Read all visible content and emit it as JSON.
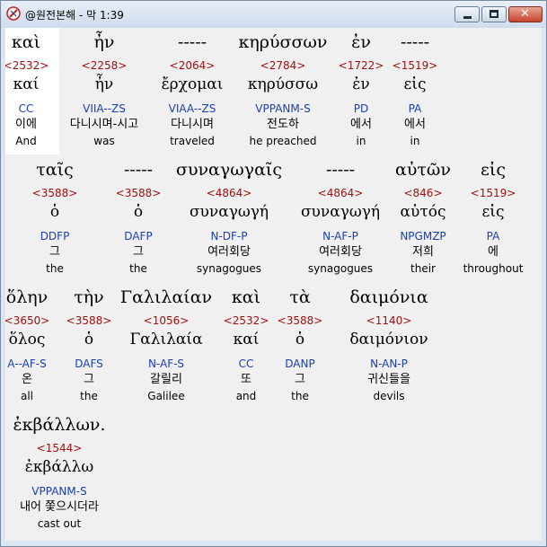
{
  "window": {
    "title": "@원전본해 - 막 1:39",
    "icon": "app-logo-icon",
    "controls": {
      "minimize": "minimize-icon",
      "maximize": "maximize-icon",
      "close": "close-icon"
    }
  },
  "rows": [
    {
      "words": [
        {
          "greek": "καὶ",
          "strong": "<2532>",
          "lemma": "καί",
          "parse": "CC",
          "korean": "이에",
          "english": "And"
        },
        {
          "greek": "ἦν",
          "strong": "<2258>",
          "lemma": "ἦν",
          "parse": "VIIA--ZS",
          "korean": "다니시며-시고",
          "english": "was"
        },
        {
          "greek": "-----",
          "strong": "<2064>",
          "lemma": "ἔρχομαι",
          "parse": "VIAA--ZS",
          "korean": "다니시며",
          "english": "traveled"
        },
        {
          "greek": "κηρύσσων",
          "strong": "<2784>",
          "lemma": "κηρύσσω",
          "parse": "VPPANM-S",
          "korean": "전도하",
          "english": "he preached"
        },
        {
          "greek": "ἐν",
          "strong": "<1722>",
          "lemma": "ἐν",
          "parse": "PD",
          "korean": "에서",
          "english": "in"
        },
        {
          "greek": "-----",
          "strong": "<1519>",
          "lemma": "εἰς",
          "parse": "PA",
          "korean": "에서",
          "english": "in"
        }
      ]
    },
    {
      "words": [
        {
          "greek": "ταῖς",
          "strong": "<3588>",
          "lemma": "ὁ",
          "parse": "DDFP",
          "korean": "그",
          "english": "the"
        },
        {
          "greek": "-----",
          "strong": "<3588>",
          "lemma": "ὁ",
          "parse": "DAFP",
          "korean": "그",
          "english": "the"
        },
        {
          "greek": "συναγωγαῖς",
          "strong": "<4864>",
          "lemma": "συναγωγή",
          "parse": "N-DF-P",
          "korean": "여러회당",
          "english": "synagogues"
        },
        {
          "greek": "-----",
          "strong": "<4864>",
          "lemma": "συναγωγή",
          "parse": "N-AF-P",
          "korean": "여러회당",
          "english": "synagogues"
        },
        {
          "greek": "αὐτῶν",
          "strong": "<846>",
          "lemma": "αὐτός",
          "parse": "NPGMZP",
          "korean": "저희",
          "english": "their"
        },
        {
          "greek": "εἰς",
          "strong": "<1519>",
          "lemma": "εἰς",
          "parse": "PA",
          "korean": "에",
          "english": "throughout"
        }
      ]
    },
    {
      "words": [
        {
          "greek": "ὅλην",
          "strong": "<3650>",
          "lemma": "ὅλος",
          "parse": "A--AF-S",
          "korean": "온",
          "english": "all"
        },
        {
          "greek": "τὴν",
          "strong": "<3588>",
          "lemma": "ὁ",
          "parse": "DAFS",
          "korean": "그",
          "english": "the"
        },
        {
          "greek": "Γαλιλαίαν",
          "strong": "<1056>",
          "lemma": "Γαλιλαία",
          "parse": "N-AF-S",
          "korean": "갈릴리",
          "english": "Galilee"
        },
        {
          "greek": "καὶ",
          "strong": "<2532>",
          "lemma": "καί",
          "parse": "CC",
          "korean": "또",
          "english": "and"
        },
        {
          "greek": "τὰ",
          "strong": "<3588>",
          "lemma": "ὁ",
          "parse": "DANP",
          "korean": "그",
          "english": "the"
        },
        {
          "greek": "δαιμόνια",
          "strong": "<1140>",
          "lemma": "δαιμόνιον",
          "parse": "N-AN-P",
          "korean": "귀신들을",
          "english": "devils"
        }
      ]
    },
    {
      "words": [
        {
          "greek": "ἐκβάλλων.",
          "strong": "<1544>",
          "lemma": "ἐκβάλλω",
          "parse": "VPPANM-S",
          "korean": "내어 쫓으시더라",
          "english": "cast out"
        }
      ]
    }
  ]
}
